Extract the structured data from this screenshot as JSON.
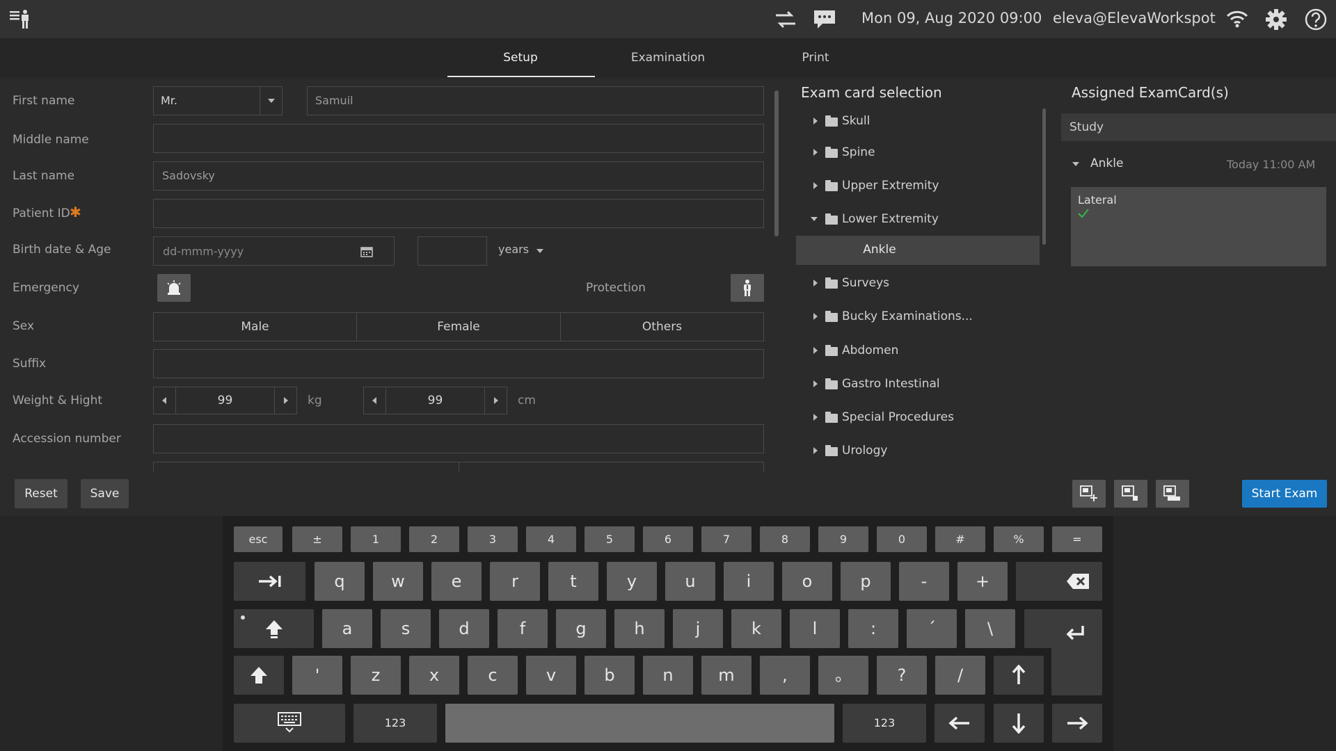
{
  "topbar": {
    "datetime": "Mon 09, Aug 2020  09:00",
    "user": "eleva@ElevaWorkspot",
    "icons": [
      "patient-list-icon",
      "swap-icon",
      "message-icon",
      "wifi-icon",
      "gear-icon",
      "help-icon"
    ]
  },
  "tabs": [
    {
      "label": "Setup",
      "active": true
    },
    {
      "label": "Examination",
      "active": false
    },
    {
      "label": "Print",
      "active": false
    }
  ],
  "form": {
    "first_name_label": "First name",
    "title_value": "Mr.",
    "first_name_value": "Samuil",
    "middle_name_label": "Middle name",
    "middle_name_value": "",
    "last_name_label": "Last name",
    "last_name_value": "Sadovsky",
    "patient_id_label": "Patient ID",
    "patient_id_required": "✱",
    "patient_id_value": "",
    "birth_label": "Birth date & Age",
    "birth_placeholder": "dd-mmm-yyyy",
    "age_value": "",
    "age_unit": "years",
    "emergency_label": "Emergency",
    "protection_label": "Protection",
    "sex_label": "Sex",
    "sex_options": [
      "Male",
      "Female",
      "Others"
    ],
    "suffix_label": "Suffix",
    "suffix_value": "",
    "weight_label": "Weight & Hight",
    "weight_value": "99",
    "weight_unit": "kg",
    "height_value": "99",
    "height_unit": "cm",
    "accession_label": "Accession number",
    "accession_value": "",
    "reset_label": "Reset",
    "save_label": "Save"
  },
  "tree": {
    "title": "Exam card selection",
    "items": [
      {
        "label": "Skull",
        "expanded": false
      },
      {
        "label": "Spine",
        "expanded": false
      },
      {
        "label": "Upper Extremity",
        "expanded": false
      },
      {
        "label": "Lower Extremity",
        "expanded": true
      },
      {
        "label": "Ankle",
        "child": true,
        "selected": true
      },
      {
        "label": "Surveys",
        "expanded": false
      },
      {
        "label": "Bucky Examinations...",
        "expanded": false
      },
      {
        "label": "Abdomen",
        "expanded": false
      },
      {
        "label": "Gastro Intestinal",
        "expanded": false
      },
      {
        "label": "Special Procedures",
        "expanded": false
      },
      {
        "label": "Urology",
        "expanded": false
      }
    ]
  },
  "assigned": {
    "title": "Assigned ExamCard(s)",
    "study_label": "Study",
    "exam_name": "Ankle",
    "exam_time": "Today  11:00 AM",
    "view_label": "Lateral",
    "start_label": "Start Exam"
  },
  "keyboard": {
    "row1": [
      "esc",
      "±",
      "1",
      "2",
      "3",
      "4",
      "5",
      "6",
      "7",
      "8",
      "9",
      "0",
      "#",
      "%",
      "="
    ],
    "row2": [
      "q",
      "w",
      "e",
      "r",
      "t",
      "y",
      "u",
      "i",
      "o",
      "p",
      "-",
      "+"
    ],
    "row3": [
      "a",
      "s",
      "d",
      "f",
      "g",
      "h",
      "j",
      "k",
      "l",
      ":",
      "´",
      "\\"
    ],
    "row4": [
      "'",
      "z",
      "x",
      "c",
      "v",
      "b",
      "n",
      "m",
      ",",
      "。",
      "?",
      "/"
    ],
    "num_label": "123"
  },
  "colors": {
    "accent_blue": "#1a78c2",
    "required_orange": "#e07b1f",
    "check_green": "#39b54a"
  }
}
